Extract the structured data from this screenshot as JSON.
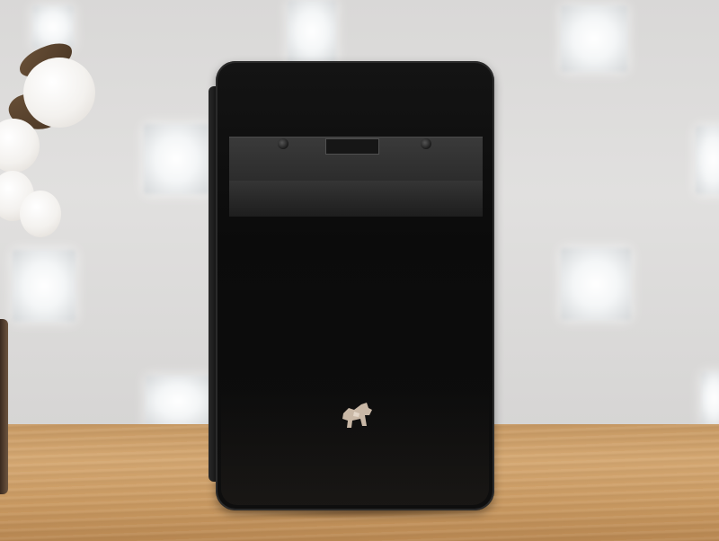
{
  "scene": {
    "description_items": [
      "wall",
      "window-blocks",
      "table",
      "projector",
      "cotton-branch",
      "vase"
    ]
  },
  "projector": {
    "logo_icon": "terrier-dog-icon",
    "body_color": "#0e0e0e",
    "logo_color": "#c9b8a6"
  },
  "colors": {
    "wall": "#dcdad8",
    "table": "#cfa06a"
  }
}
